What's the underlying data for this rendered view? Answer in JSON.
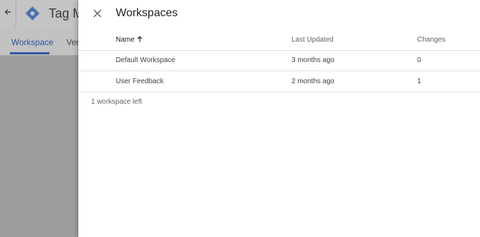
{
  "background": {
    "app_title": "Tag M",
    "tabs": {
      "workspace": "Workspace",
      "versions": "Ver"
    }
  },
  "panel": {
    "title": "Workspaces",
    "columns": {
      "name": "Name",
      "last_updated": "Last Updated",
      "changes": "Changes"
    },
    "rows": [
      {
        "name": "Default Workspace",
        "last_updated": "3 months ago",
        "changes": "0"
      },
      {
        "name": "User Feedback",
        "last_updated": "2 months ago",
        "changes": "1"
      }
    ],
    "remaining_text": "1 workspace left"
  },
  "colors": {
    "accent": "#2e56a6",
    "logo": "#4a6fb5"
  },
  "icons": {
    "back": "arrow-back-icon",
    "logo": "tag-manager-logo-icon",
    "close": "close-icon",
    "sort": "arrow-up-icon"
  }
}
